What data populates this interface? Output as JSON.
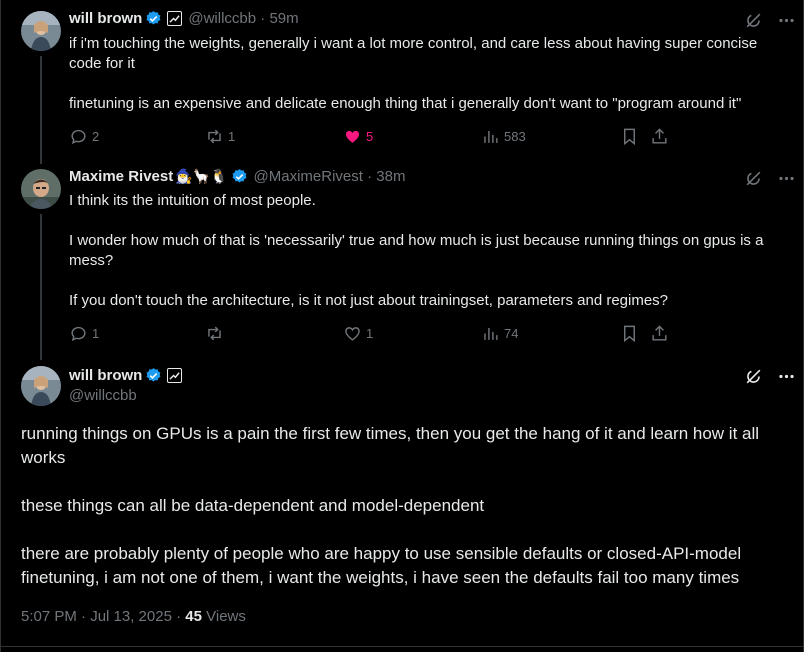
{
  "tweets": [
    {
      "name": "will brown",
      "handle": "@willccbb",
      "time": "59m",
      "text": "if i'm touching the weights, generally i want a lot more control, and care less about having super concise\ncode for it\n\nfinetuning is an expensive and delicate enough thing that i generally don't want to \"program around it\"",
      "replies": "2",
      "reposts": "1",
      "likes": "5",
      "views": "583"
    },
    {
      "name": "Maxime Rivest",
      "emojis": "🧙‍♂️🦙🐧",
      "handle": "@MaximeRivest",
      "time": "38m",
      "text": "I think its the intuition of most people.\n\nI wonder how much of that is 'necessarily' true and how much is just because running things on gpus is a\nmess?\n\nIf you don't touch the architecture, is it not just about trainingset, parameters and regimes?",
      "replies": "1",
      "reposts": "",
      "likes": "1",
      "views": "74"
    }
  ],
  "main_tweet": {
    "name": "will brown",
    "handle": "@willccbb",
    "text": "running things on GPUs is a pain the first few times, then you get the hang of it and learn how it all\nworks\n\nthese things can all be data-dependent and model-dependent\n\nthere are probably plenty of people who are happy to use sensible defaults or closed-API-model\nfinetuning, i am not one of them, i want the weights, i have seen the defaults fail too many times",
    "timestamp": "5:07 PM · Jul 13, 2025",
    "views_count": "45",
    "views_label": "Views"
  },
  "colors": {
    "background": "#000000",
    "text": "#e7e9ea",
    "muted": "#71767b",
    "like_active": "#f91880",
    "verified": "#1d9bf0"
  },
  "icons": [
    "verified-badge-icon",
    "affiliate-badge-icon",
    "grok-icon",
    "more-icon",
    "reply-icon",
    "repost-icon",
    "like-icon",
    "views-icon",
    "bookmark-icon",
    "share-icon"
  ]
}
